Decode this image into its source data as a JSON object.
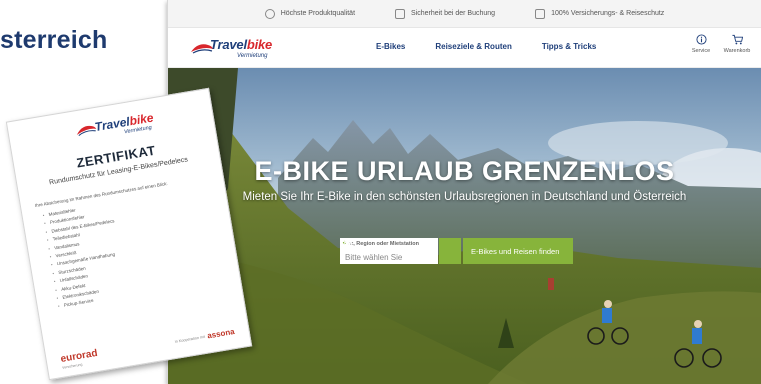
{
  "heading": "sterreich",
  "trust_bar": [
    {
      "icon": "award-icon",
      "label": "Höchste Produktqualität"
    },
    {
      "icon": "lock-icon",
      "label": "Sicherheit bei der Buchung"
    },
    {
      "icon": "checkbox-icon",
      "label": "100% Versicherungs- & Reiseschutz"
    }
  ],
  "brand": {
    "name_part1": "Travel",
    "name_part2": "bike",
    "sub": "Vermietung",
    "primary_color": "#1f3f7a",
    "accent_color": "#d8262c"
  },
  "nav": {
    "items": [
      "E-Bikes",
      "Reiseziele & Routen",
      "Tipps & Tricks"
    ],
    "service_label": "Service",
    "cart_label": "Warenkorb"
  },
  "hero": {
    "title": "E-BIKE URLAUB GRENZENLOS",
    "subtitle": "Mieten Sie Ihr E-Bike in den schönsten Urlaubsregionen in Deutschland und Österreich"
  },
  "search": {
    "label": "Ort, Region oder Mietstation",
    "placeholder": "Bitte wählen Sie",
    "button_label": "E-Bikes und Reisen finden",
    "button_color": "#87b43b"
  },
  "certificate": {
    "brand_part1": "Travel",
    "brand_part2": "bike",
    "brand_sub": "Vermietung",
    "title": "ZERTIFIKAT",
    "subtitle": "Rundumschutz für Leasing-E-Bikes/Pedelecs",
    "intro": "Ihre Absicherung im Rahmen des Rundumschutzes auf einen Blick:",
    "items": [
      "Materialfehler",
      "Produktionsfehler",
      "Diebstahl des E-Bikes/Pedelecs",
      "Teilediebstahl",
      "Vandalismus",
      "Verschleiß",
      "Unsachgemäße Handhabung",
      "Sturzschäden",
      "Unfallschäden",
      "Akku-Defekt",
      "Elektronikschäden",
      "Pickup-Service"
    ],
    "partner_text": "in Kooperation mit",
    "footer_brand": "eurorad",
    "footer_sub": "Versicherung",
    "partner_brand": "assona"
  }
}
